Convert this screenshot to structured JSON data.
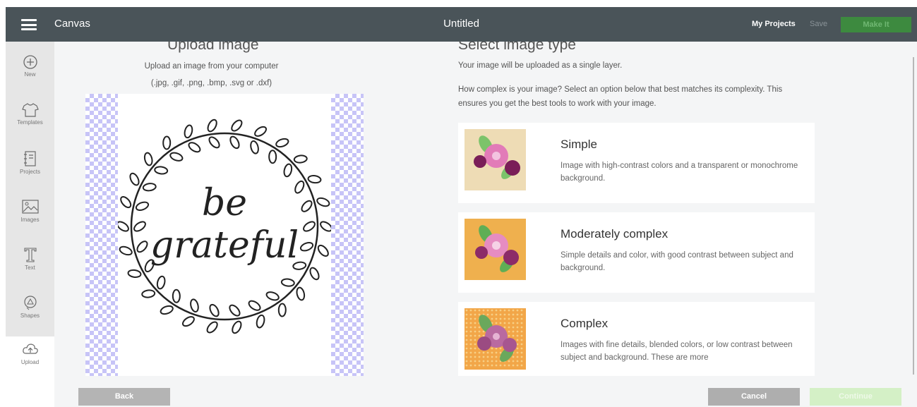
{
  "topbar": {
    "menu_icon": "hamburger-icon",
    "app_name": "Canvas",
    "title": "Untitled",
    "my_projects": "My Projects",
    "save": "Save",
    "make_it": "Make It"
  },
  "sidebar": {
    "items": [
      {
        "label": "New",
        "icon": "plus-circle-icon"
      },
      {
        "label": "Templates",
        "icon": "tshirt-icon"
      },
      {
        "label": "Projects",
        "icon": "notebook-icon"
      },
      {
        "label": "Images",
        "icon": "image-icon"
      },
      {
        "label": "Text",
        "icon": "text-t-icon"
      },
      {
        "label": "Shapes",
        "icon": "shapes-icon"
      },
      {
        "label": "Upload",
        "icon": "cloud-upload-icon"
      }
    ],
    "active": "Upload"
  },
  "upload": {
    "heading": "Upload image",
    "subtitle": "Upload an image from your computer",
    "formats": "(.jpg, .gif, .png, .bmp, .svg or .dxf)",
    "preview_text_line1": "be",
    "preview_text_line2": "grateful"
  },
  "select": {
    "heading": "Select image type",
    "description": "Your image will be uploaded as a single layer.",
    "question": "How complex is your image? Select an option below that best matches its complexity. This ensures you get the best tools to work with your image.",
    "options": [
      {
        "title": "Simple",
        "description": "Image with high-contrast colors and a transparent or monochrome background.",
        "thumb_bg": "#eedcb5"
      },
      {
        "title": "Moderately complex",
        "description": "Simple details and color, with good contrast between subject and background.",
        "thumb_bg": "#efb04e"
      },
      {
        "title": "Complex",
        "description": "Images with fine details, blended colors, or low contrast between subject and background. These are more",
        "thumb_bg": "#f2a648"
      }
    ]
  },
  "footer": {
    "back": "Back",
    "cancel": "Cancel",
    "continue": "Continue"
  },
  "colors": {
    "topbar": "#4a5459",
    "make_it": "#3d8a3f",
    "checker": "#c7c4f7",
    "continue": "#d4f0c6"
  }
}
